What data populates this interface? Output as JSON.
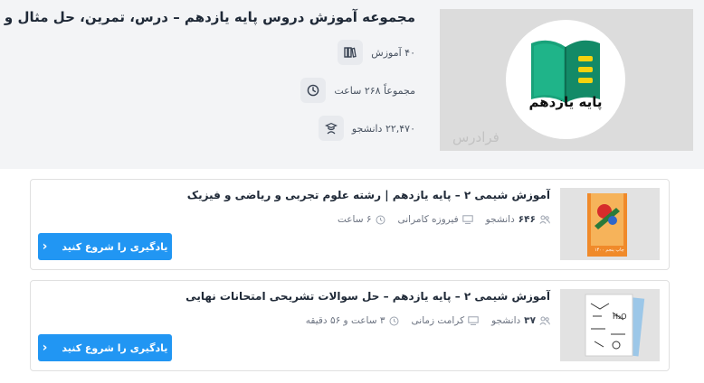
{
  "collection": {
    "title": "مجموعه آموزش دروس پایه یازدهم – درس، تمرین، حل مثال و تست",
    "hero_label": "پایه یازدهم",
    "watermark": "فرادرس",
    "stats": {
      "tutorials": "۴۰ آموزش",
      "hours": "مجموعاً ۲۶۸ ساعت",
      "students": "۲۲,۴۷۰ دانشجو"
    }
  },
  "courses": [
    {
      "title": "آموزش شیمی ۲ – پایه یازدهم | رشته علوم تجربی و ریاضی و فیزیک",
      "students": "۶۴۶",
      "students_label": "دانشجو",
      "teacher": "فیروزه کامرانی",
      "duration": "۶ ساعت",
      "button": "یادگیری را شروع کنید",
      "thumb_text": "چاپ پنجم ۱۴۰۰"
    },
    {
      "title": "آموزش شیمی ۲ – پایه یازدهم – حل سوالات تشریحی امتحانات نهایی",
      "students": "۳۷",
      "students_label": "دانشجو",
      "teacher": "کرامت زمانی",
      "duration": "۳ ساعت و ۵۶ دقیقه",
      "button": "یادگیری را شروع کنید",
      "thumb_text": "H₂O"
    }
  ],
  "colors": {
    "accent": "#2196f3",
    "header_bg": "#f3f4f6",
    "book_green": "#18a27a",
    "book_yellow": "#f5d20e"
  },
  "icons": [
    "books-icon",
    "clock-icon",
    "student-icon",
    "users-icon",
    "teacher-icon",
    "chevron-left-icon"
  ]
}
